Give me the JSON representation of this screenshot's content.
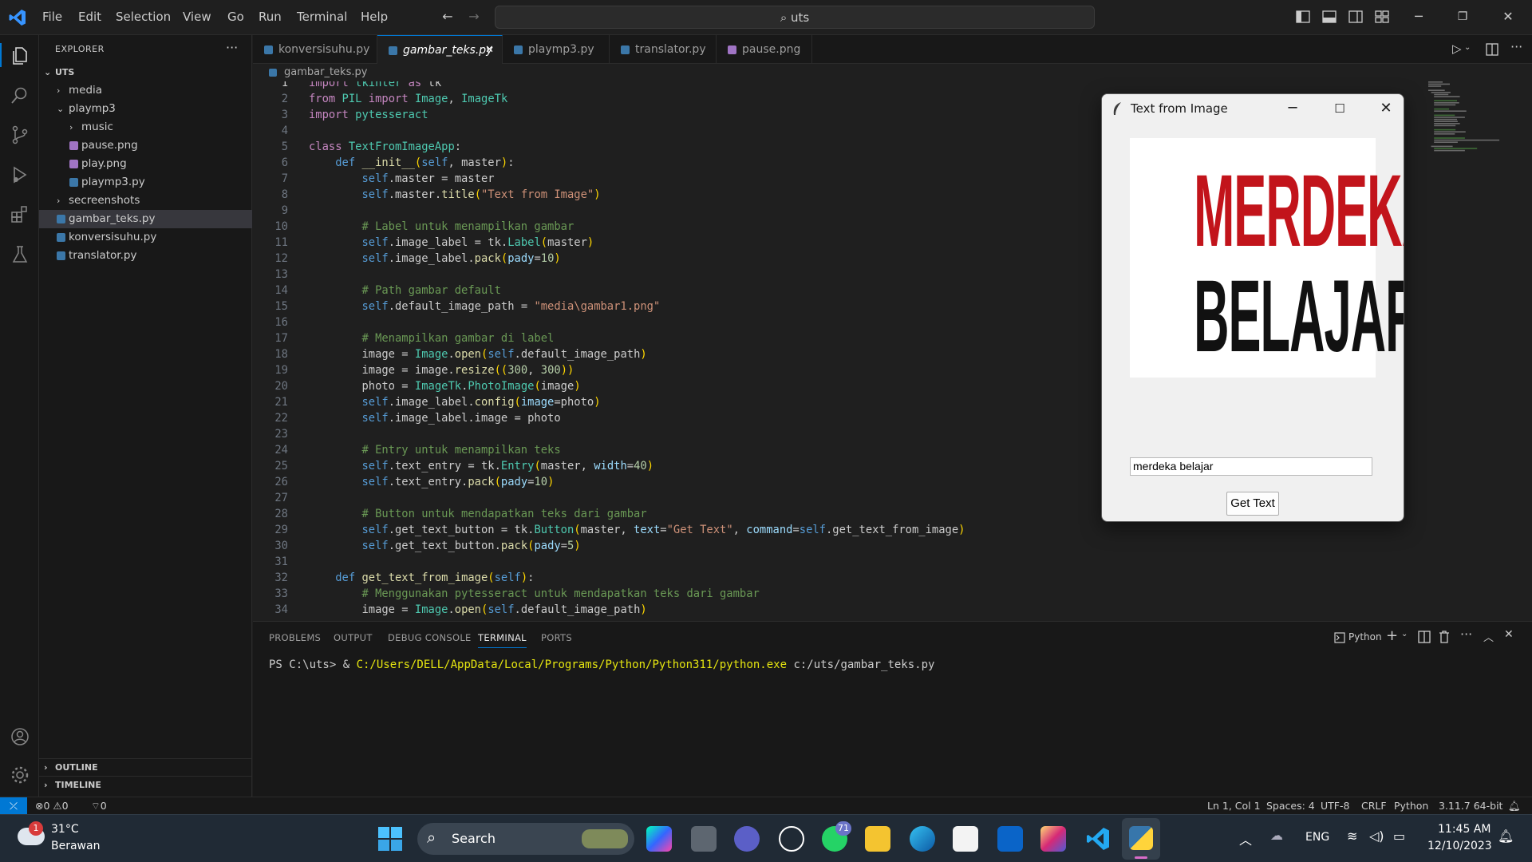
{
  "menu": [
    "File",
    "Edit",
    "Selection",
    "View",
    "Go",
    "Run",
    "Terminal",
    "Help"
  ],
  "search": {
    "text": "uts",
    "icon": "search-icon"
  },
  "sidebar": {
    "title": "EXPLORER",
    "root": "UTS",
    "items": [
      {
        "label": "media",
        "type": "folder",
        "depth": 1,
        "expanded": false
      },
      {
        "label": "playmp3",
        "type": "folder",
        "depth": 1,
        "expanded": true
      },
      {
        "label": "music",
        "type": "folder",
        "depth": 2,
        "expanded": false
      },
      {
        "label": "pause.png",
        "type": "image",
        "depth": 2
      },
      {
        "label": "play.png",
        "type": "image",
        "depth": 2
      },
      {
        "label": "playmp3.py",
        "type": "python",
        "depth": 2
      },
      {
        "label": "secreenshots",
        "type": "folder",
        "depth": 1,
        "expanded": false
      },
      {
        "label": "gambar_teks.py",
        "type": "python",
        "depth": 1,
        "selected": true
      },
      {
        "label": "konversisuhu.py",
        "type": "python",
        "depth": 1
      },
      {
        "label": "translator.py",
        "type": "python",
        "depth": 1
      }
    ],
    "outline": "OUTLINE",
    "timeline": "TIMELINE"
  },
  "tabs": [
    {
      "label": "konversisuhu.py",
      "type": "python"
    },
    {
      "label": "gambar_teks.py",
      "type": "python",
      "active": true
    },
    {
      "label": "playmp3.py",
      "type": "python"
    },
    {
      "label": "translator.py",
      "type": "python"
    },
    {
      "label": "pause.png",
      "type": "image"
    }
  ],
  "breadcrumb": "gambar_teks.py",
  "code": [
    "import tkinter as tk",
    "from PIL import Image, ImageTk",
    "import pytesseract",
    "",
    "class TextFromImageApp:",
    "    def __init__(self, master):",
    "        self.master = master",
    "        self.master.title(\"Text from Image\")",
    "",
    "        # Label untuk menampilkan gambar",
    "        self.image_label = tk.Label(master)",
    "        self.image_label.pack(pady=10)",
    "",
    "        # Path gambar default",
    "        self.default_image_path = \"media\\gambar1.png\"",
    "",
    "        # Menampilkan gambar di label",
    "        image = Image.open(self.default_image_path)",
    "        image = image.resize((300, 300))",
    "        photo = ImageTk.PhotoImage(image)",
    "        self.image_label.config(image=photo)",
    "        self.image_label.image = photo",
    "",
    "        # Entry untuk menampilkan teks",
    "        self.text_entry = tk.Entry(master, width=40)",
    "        self.text_entry.pack(pady=10)",
    "",
    "        # Button untuk mendapatkan teks dari gambar",
    "        self.get_text_button = tk.Button(master, text=\"Get Text\", command=self.get_text_from_image)",
    "        self.get_text_button.pack(pady=5)",
    "",
    "    def get_text_from_image(self):",
    "        # Menggunakan pytesseract untuk mendapatkan teks dari gambar",
    "        image = Image.open(self.default_image_path)"
  ],
  "panel": {
    "tabs": [
      "PROBLEMS",
      "OUTPUT",
      "DEBUG CONSOLE",
      "TERMINAL",
      "PORTS"
    ],
    "active": "TERMINAL",
    "terminal_label": "Python",
    "prompt": "PS C:\\uts> & ",
    "exe": "C:/Users/DELL/AppData/Local/Programs/Python/Python311/python.exe",
    "arg": " c:/uts/gambar_teks.py"
  },
  "statusbar": {
    "errors": "0",
    "warnings": "0",
    "ports": "0",
    "position": "Ln 1, Col 1",
    "spaces": "Spaces: 4",
    "encoding": "UTF-8",
    "eol": "CRLF",
    "language": "Python",
    "interpreter": "3.11.7 64-bit"
  },
  "tkwindow": {
    "title": "Text from Image",
    "image_line1": "MERDEKA",
    "image_line2": "BELAJAR",
    "image_color1": "#c2141b",
    "image_color2": "#111111",
    "entry_value": "merdeka belajar",
    "button": "Get Text"
  },
  "taskbar": {
    "weather_temp": "31°C",
    "weather_desc": "Berawan",
    "weather_badge": "1",
    "search": "Search",
    "whatsapp_badge": "71",
    "lang": "ENG",
    "time": "11:45 AM",
    "date": "12/10/2023"
  }
}
